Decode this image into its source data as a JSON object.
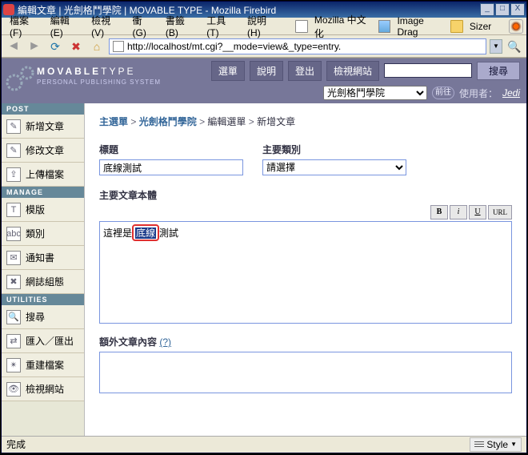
{
  "window": {
    "title": "編輯文章 | 光劍格鬥學院 | MOVABLE TYPE - Mozilla Firebird"
  },
  "menu": {
    "file": "檔案(F)",
    "edit": "編輯(E)",
    "view": "檢視(V)",
    "go": "衝(G)",
    "bookmarks": "書籤(B)",
    "tools": "工具(T)",
    "help": "說明(H)",
    "m1": "Mozilla 中文化",
    "m2": "Image Drag",
    "m3": "Sizer"
  },
  "url": "http://localhost/mt.cgi?__mode=view&_type=entry.",
  "logo": {
    "brand_a": "MOVABLE",
    "brand_b": "TYPE",
    "tag": "PERSONAL PUBLISHING SYSTEM"
  },
  "topnav": {
    "menu": "選單",
    "help": "說明",
    "logout": "登出",
    "viewsite": "檢視網站",
    "search": "搜尋"
  },
  "subnav": {
    "blog": "光劍格鬥學院",
    "go": "前往",
    "userlabel": "使用者：",
    "user": "Jedi"
  },
  "sidebar": {
    "post": "POST",
    "manage": "MANAGE",
    "utilities": "UTILITIES",
    "items": [
      "新增文章",
      "修改文章",
      "上傳檔案",
      "模版",
      "類別",
      "通知書",
      "網誌組態",
      "搜尋",
      "匯入／匯出",
      "重建檔案",
      "檢視網站"
    ],
    "icons": [
      "✎",
      "✎",
      "⇪",
      "T",
      "abc",
      "✉",
      "✖",
      "🔍",
      "⇄",
      "✴",
      "👁"
    ]
  },
  "breadcrumb": {
    "a": "主選單",
    "b": "光劍格鬥學院",
    "c": "編輯選單",
    "d": "新增文章",
    "sep": " > "
  },
  "fields": {
    "title_lbl": "標題",
    "title_val": "底線測試",
    "cat_lbl": "主要類別",
    "cat_val": "請選擇",
    "body_lbl": "主要文章本體",
    "ext_lbl": "額外文章內容",
    "ext_q": "(?)"
  },
  "editor": {
    "before": "這裡是",
    "sel": "底線",
    "after": "測試"
  },
  "format": {
    "b": "B",
    "i": "i",
    "u": "U",
    "url": "URL"
  },
  "status": {
    "done": "完成",
    "style": "Style"
  }
}
